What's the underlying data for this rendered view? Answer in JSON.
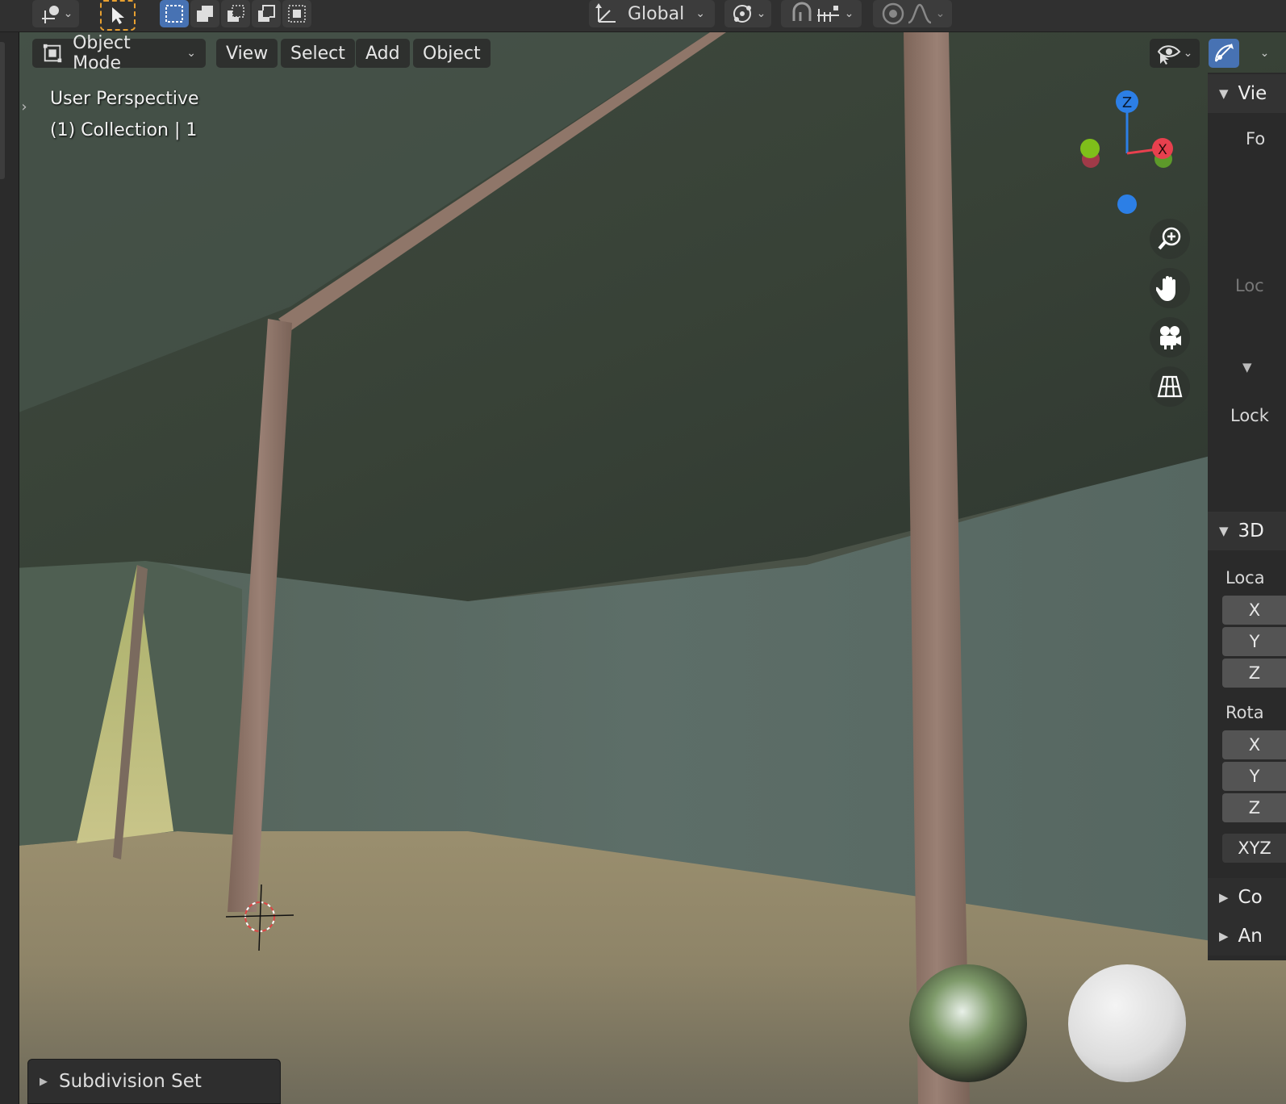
{
  "toolbar": {
    "transform_orientation": "Global",
    "icons": [
      "select-tool-icon",
      "select-box-new-icon",
      "select-box-extend-icon",
      "select-box-subtract-icon",
      "select-box-invert-icon",
      "select-box-intersect-icon",
      "orientation-icon",
      "pivot-point-icon",
      "snap-icon",
      "snap-increment-icon",
      "proportional-edit-icon",
      "falloff-icon"
    ]
  },
  "header": {
    "mode": "Object Mode",
    "menu": {
      "view": "View",
      "select": "Select",
      "add": "Add",
      "object": "Object"
    }
  },
  "viewport": {
    "perspective_label": "User Perspective",
    "collection_label": "(1) Collection | 1",
    "gizmo": {
      "z": "Z",
      "x": "X"
    }
  },
  "npanel": {
    "view_header": "Vie",
    "focal_label": "Fo",
    "lock_dim_label": "Loc",
    "lock_label": "Lock",
    "cursor_header": "3D",
    "location_label": "Loca",
    "rotation_label": "Rota",
    "axes": {
      "x": "X",
      "y": "Y",
      "z": "Z"
    },
    "rotation_mode": "XYZ",
    "collections_header": "Co",
    "annotations_header": "An"
  },
  "operator_panel": {
    "label": "Subdivision Set"
  },
  "colors": {
    "accent": "#4772b3",
    "axis_x": "#e8404e",
    "axis_y": "#7fbf1a",
    "axis_z": "#2c7fe6"
  }
}
